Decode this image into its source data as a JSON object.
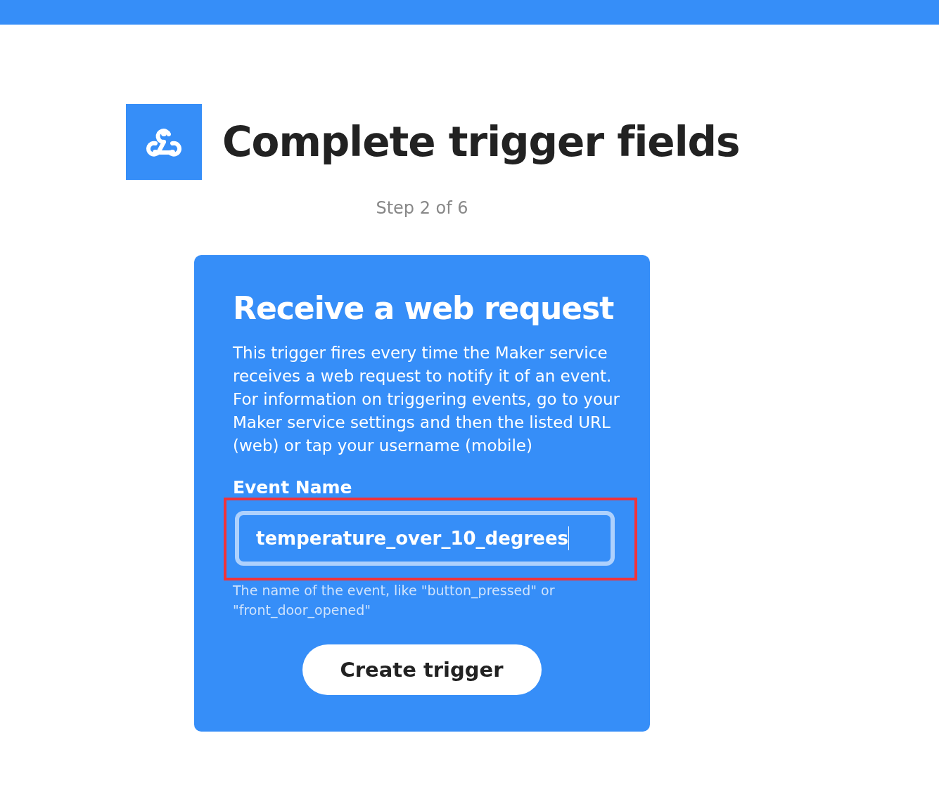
{
  "header": {
    "title": "Complete trigger fields",
    "step": "Step 2 of 6"
  },
  "card": {
    "title": "Receive a web request",
    "description": "This trigger fires every time the Maker service receives a web request to notify it of an event. For information on triggering events, go to your Maker service settings and then the listed URL (web) or tap your username (mobile)",
    "field": {
      "label": "Event Name",
      "value": "temperature_over_10_degrees",
      "highlighted": true,
      "hint": "The name of the event, like \"button_pressed\" or \"front_door_opened\""
    },
    "button": "Create trigger"
  }
}
